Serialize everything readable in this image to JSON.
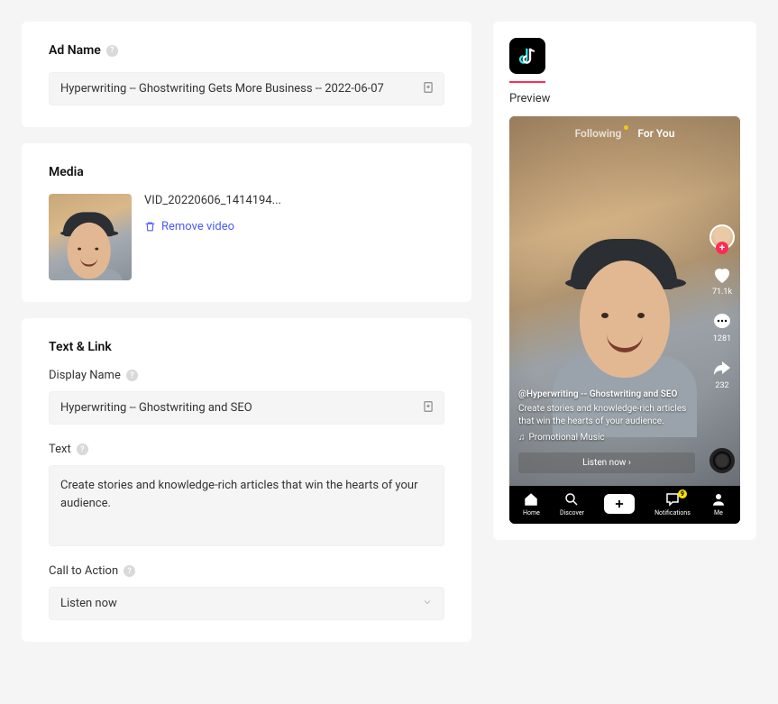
{
  "adName": {
    "label": "Ad Name",
    "value": "Hyperwriting -- Ghostwriting Gets More Business -- 2022-06-07"
  },
  "media": {
    "label": "Media",
    "fileName": "VID_20220606_1414194...",
    "removeLabel": "Remove video"
  },
  "textLink": {
    "sectionLabel": "Text & Link",
    "displayNameLabel": "Display Name",
    "displayNameValue": "Hyperwriting -- Ghostwriting and SEO",
    "textLabel": "Text",
    "textValue": "Create stories and knowledge-rich articles that win the hearts of your audience.",
    "ctaLabel": "Call to Action",
    "ctaValue": "Listen now"
  },
  "preview": {
    "label": "Preview",
    "tabs": {
      "following": "Following",
      "forYou": "For You"
    },
    "rail": {
      "likes": "71.1k",
      "comments": "1281",
      "shares": "232"
    },
    "handle": "@Hyperwriting -- Ghostwriting and SEO",
    "caption": "Create stories and knowledge-rich articles that win the hearts of your audience.",
    "music": "Promotional Music",
    "ctaPill": "Listen now ›",
    "nav": {
      "home": "Home",
      "discover": "Discover",
      "notifications": "Notifications",
      "me": "Me",
      "badge": "9"
    }
  }
}
